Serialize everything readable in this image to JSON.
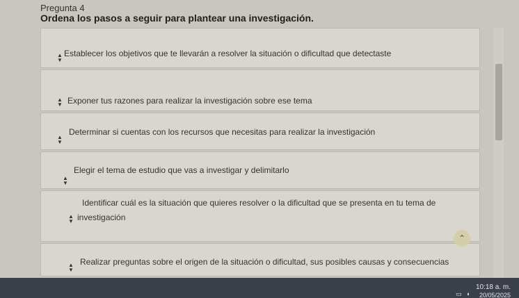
{
  "question": {
    "number_label": "Pregunta 4",
    "title": "Ordena los pasos a seguir para plantear una investigación."
  },
  "items": [
    {
      "text": "Establecer los objetivos que te llevarán a resolver la situación o dificultad que detectaste"
    },
    {
      "text": "Exponer tus razones para realizar la investigación sobre ese tema"
    },
    {
      "text": "Determinar si cuentas con los recursos que necesitas para realizar la investigación"
    },
    {
      "text": "Elegir el tema de estudio que vas a investigar y delimitarlo"
    },
    {
      "text_line1": "Identificar cuál es la situación que quieres resolver o la dificultad que se presenta en tu tema de",
      "text_line2": "investigación"
    },
    {
      "text": "Realizar preguntas sobre el origen de la situación o dificultad, sus posibles causas y consecuencias"
    }
  ],
  "taskbar": {
    "time": "10:18 a. m.",
    "date": "20/05/2025"
  },
  "icons": {
    "move_up": "chevron-up-icon",
    "move_down": "chevron-down-icon",
    "scroll_top": "double-chevron-up-icon"
  }
}
